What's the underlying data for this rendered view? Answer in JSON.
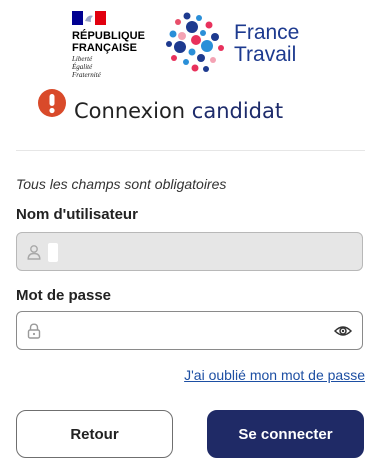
{
  "header": {
    "rf_logo": {
      "title_line1": "RÉPUBLIQUE",
      "title_line2": "FRANÇAISE",
      "motto_line1": "Liberté",
      "motto_line2": "Égalité",
      "motto_line3": "Fraternité"
    },
    "ft_logo": {
      "line1": "France",
      "line2": "Travail"
    }
  },
  "title": {
    "part1": "Connexion ",
    "part2": "candidat",
    "icon": "alert-icon"
  },
  "form": {
    "required_note": "Tous les champs sont obligatoires",
    "username": {
      "label": "Nom d'utilisateur",
      "icon": "user-icon"
    },
    "password": {
      "label": "Mot de passe",
      "value": "",
      "icon": "lock-icon",
      "toggle_icon": "eye-icon"
    },
    "forgot_link": "J'ai oublié mon mot de passe",
    "buttons": {
      "back": "Retour",
      "login": "Se connecter"
    }
  },
  "colors": {
    "brand_navy": "#1f2a66",
    "title_navy": "#1d2b6b",
    "ft_blue": "#1d3a8f",
    "link": "#1d4fa3",
    "alert_red": "#d94a2a",
    "disabled_bg": "#e6e6e6"
  }
}
